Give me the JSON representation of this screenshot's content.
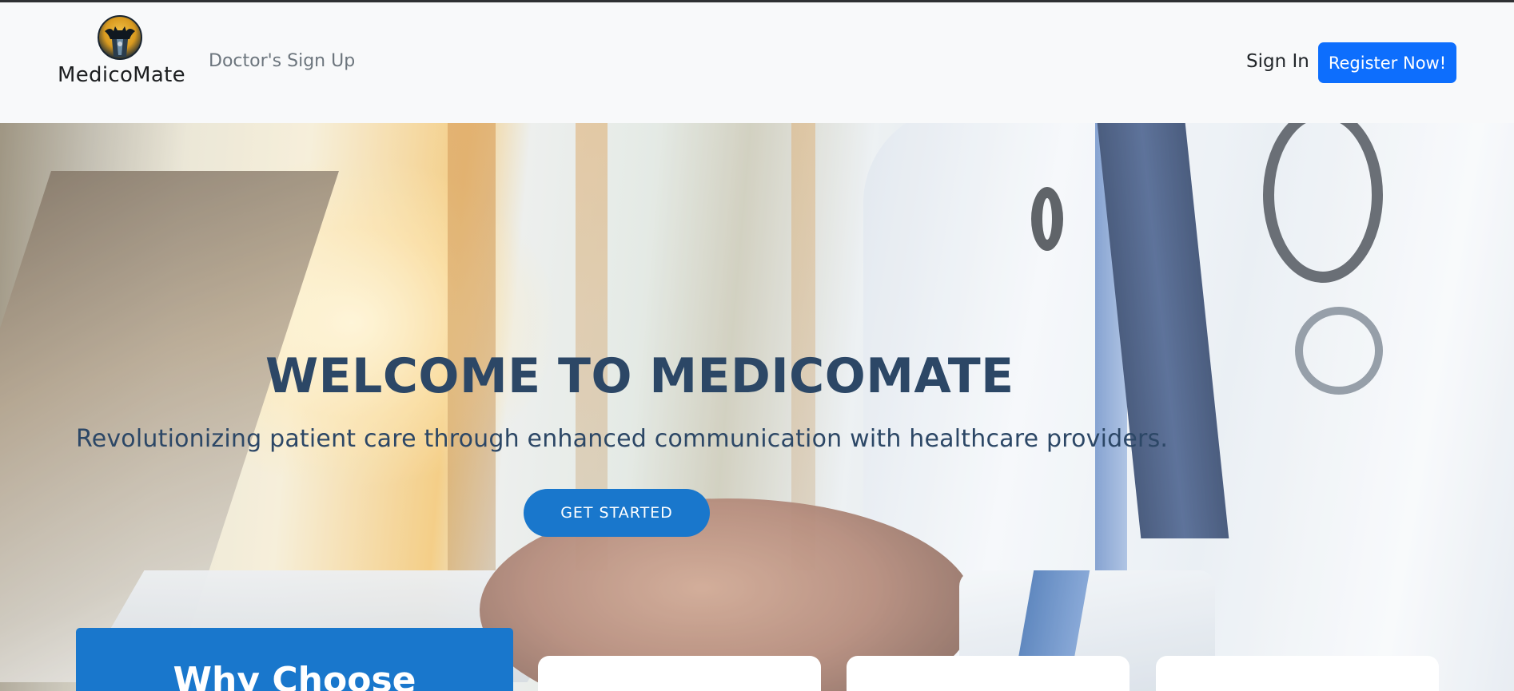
{
  "navbar": {
    "brand_name": "MedicoMate",
    "doctor_signup_label": "Doctor's Sign Up",
    "signin_label": "Sign In",
    "register_label": "Register Now!"
  },
  "hero": {
    "title": "WELCOME TO MEDICOMATE",
    "subtitle": "Revolutionizing patient care through enhanced communication with healthcare providers.",
    "cta_label": "GET STARTED"
  },
  "why": {
    "title": "Why Choose"
  },
  "colors": {
    "primary": "#1977cc",
    "register_button": "#0d6efd",
    "hero_text": "#2c4766",
    "navbar_bg": "#f8f9fa"
  },
  "icons": {
    "brand_logo": "batman-doctor-logo-icon"
  }
}
